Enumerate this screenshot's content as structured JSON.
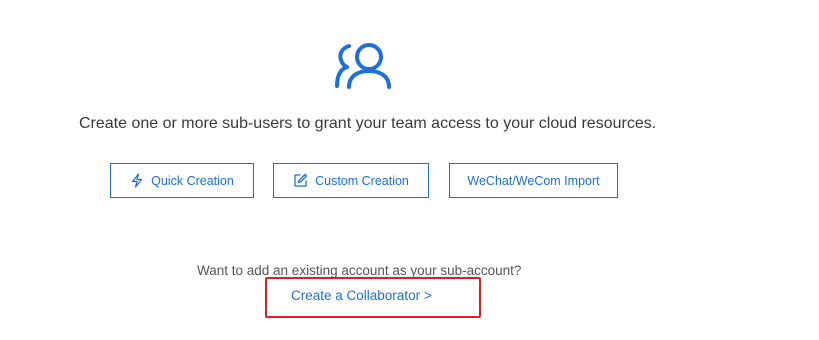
{
  "colors": {
    "accent": "#1e6fd9",
    "text": "#3a3a3a",
    "muted_text": "#555555",
    "highlight_box": "#e02020",
    "background": "#ffffff"
  },
  "hero": {
    "icon": "users-icon",
    "headline": "Create one or more sub-users to grant your team access to your cloud resources."
  },
  "actions": [
    {
      "icon": "lightning-icon",
      "label": "Quick Creation"
    },
    {
      "icon": "edit-icon",
      "label": "Custom Creation"
    },
    {
      "icon": null,
      "label": "WeChat/WeCom Import"
    }
  ],
  "collaborator": {
    "prompt": "Want to add an existing account as your sub-account?",
    "link_label": "Create a Collaborator >"
  }
}
